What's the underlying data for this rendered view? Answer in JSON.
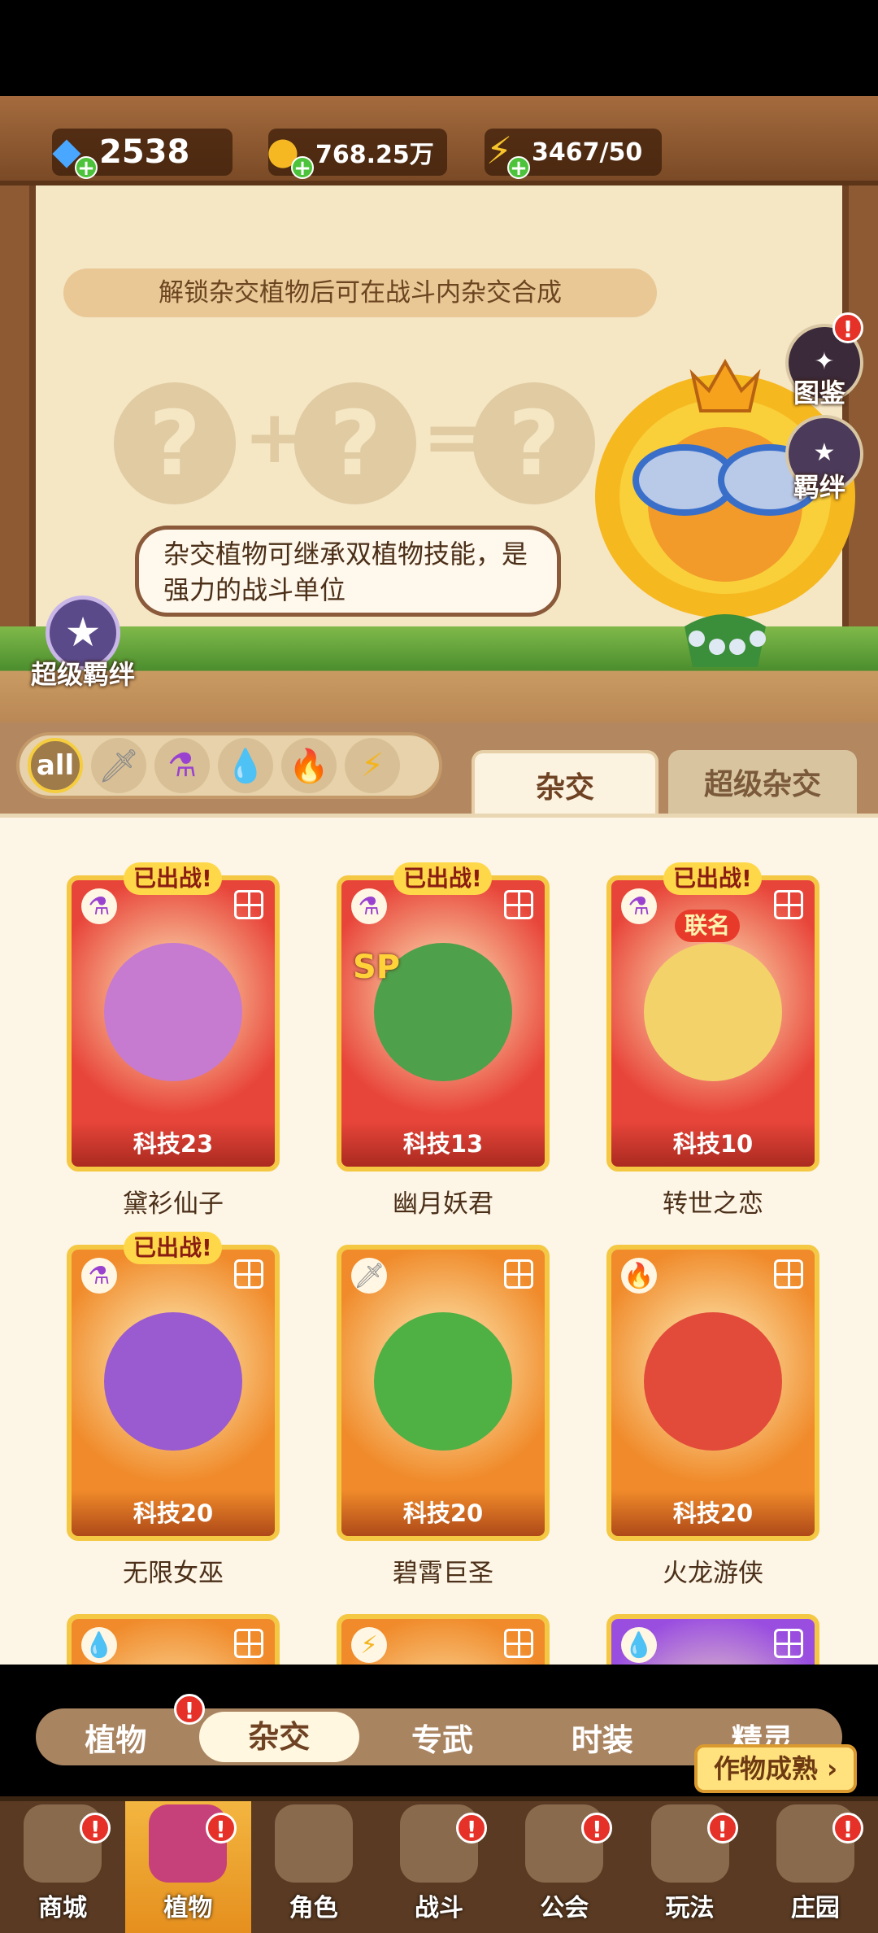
{
  "resources": {
    "diamonds": "2538",
    "coins": "768.25万",
    "energy": "3467/50"
  },
  "banner": {
    "hint": "解锁杂交植物后可在战斗内杂交合成",
    "formula": [
      "?",
      "+",
      "?",
      "=",
      "?"
    ],
    "bubble": "杂交植物可继承双植物技能，是强力的战斗单位",
    "super_bond": "超级羁绊",
    "side_buttons": [
      {
        "label": "图鉴",
        "badge": "!"
      },
      {
        "label": "羁绊",
        "badge": ""
      }
    ]
  },
  "filters": {
    "chips": [
      {
        "icon": "all-icon",
        "label": "all",
        "active": true
      },
      {
        "icon": "sword-icon",
        "label": "",
        "active": false
      },
      {
        "icon": "potion-icon",
        "label": "",
        "active": false
      },
      {
        "icon": "water-drop-icon",
        "label": "",
        "active": false
      },
      {
        "icon": "fire-icon",
        "label": "",
        "active": false
      },
      {
        "icon": "lightning-icon",
        "label": "",
        "active": false
      }
    ],
    "tabs": [
      "杂交",
      "超级杂交"
    ],
    "active_tab": 0
  },
  "cards": [
    {
      "name": "黛衫仙子",
      "level": "科技23",
      "deployed": "已出战!",
      "tag": "",
      "element": "potion-icon",
      "sp": false,
      "color": "#e8453a",
      "face": "#c67ad0"
    },
    {
      "name": "幽月妖君",
      "level": "科技13",
      "deployed": "已出战!",
      "tag": "",
      "element": "potion-icon",
      "sp": true,
      "color": "#e8453a",
      "face": "#4ea04a"
    },
    {
      "name": "转世之恋",
      "level": "科技10",
      "deployed": "已出战!",
      "tag": "联名",
      "element": "potion-icon",
      "sp": false,
      "color": "#e8453a",
      "face": "#f3d26a"
    },
    {
      "name": "无限女巫",
      "level": "科技20",
      "deployed": "已出战!",
      "tag": "",
      "element": "potion-icon",
      "sp": false,
      "color": "#f08a2a",
      "face": "#9a5ad0"
    },
    {
      "name": "碧霄巨圣",
      "level": "科技20",
      "deployed": "",
      "tag": "",
      "element": "sword-icon",
      "sp": false,
      "color": "#f08a2a",
      "face": "#4fb044"
    },
    {
      "name": "火龙游侠",
      "level": "科技20",
      "deployed": "",
      "tag": "",
      "element": "fire-icon",
      "sp": false,
      "color": "#f08a2a",
      "face": "#e24a3a"
    },
    {
      "name": "",
      "level": "",
      "deployed": "",
      "tag": "",
      "element": "water-drop-icon",
      "sp": false,
      "color": "#f08a2a",
      "face": ""
    },
    {
      "name": "",
      "level": "",
      "deployed": "",
      "tag": "",
      "element": "lightning-icon",
      "sp": false,
      "color": "#f08a2a",
      "face": ""
    },
    {
      "name": "",
      "level": "",
      "deployed": "",
      "tag": "",
      "element": "water-drop-icon",
      "sp": false,
      "color": "#9a4ee0",
      "face": ""
    }
  ],
  "categories": [
    {
      "label": "植物",
      "badge": "!"
    },
    {
      "label": "杂交",
      "badge": ""
    },
    {
      "label": "专武",
      "badge": ""
    },
    {
      "label": "时装",
      "badge": ""
    },
    {
      "label": "精灵",
      "badge": ""
    }
  ],
  "active_category": 1,
  "harvest_button": "作物成熟",
  "nav": [
    {
      "label": "商城",
      "badge": "!",
      "active": false
    },
    {
      "label": "植物",
      "badge": "!",
      "active": true
    },
    {
      "label": "角色",
      "badge": "",
      "active": false
    },
    {
      "label": "战斗",
      "badge": "!",
      "active": false
    },
    {
      "label": "公会",
      "badge": "!",
      "active": false
    },
    {
      "label": "玩法",
      "badge": "!",
      "active": false
    },
    {
      "label": "庄园",
      "badge": "!",
      "active": false
    }
  ],
  "colors": {
    "accent_gold": "#f4c842",
    "badge_red": "#e53128",
    "wood": "#6e4222"
  }
}
